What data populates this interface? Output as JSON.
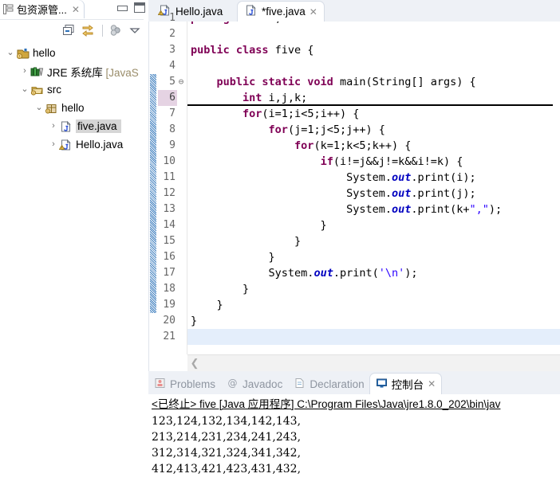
{
  "explorer": {
    "tab_label": "包资源管...",
    "tab_close": "✕",
    "toolbar": [
      {
        "name": "collapse-all-icon",
        "title": "全部折叠"
      },
      {
        "name": "link-with-editor-icon",
        "title": "与编辑器链接"
      },
      {
        "name": "focus-on-active-task-icon",
        "title": "聚焦于活动任务"
      },
      {
        "name": "view-menu-icon",
        "title": "视图菜单"
      }
    ],
    "window_buttons": {
      "minimize": "最小化",
      "maximize": "最大化"
    },
    "tree": [
      {
        "indent": 0,
        "twisty": "v",
        "icon": "java-project-icon",
        "label": "hello",
        "dim": "",
        "selected": false
      },
      {
        "indent": 1,
        "twisty": ">",
        "icon": "jre-library-icon",
        "label": "JRE 系统库 ",
        "dim": "[JavaS",
        "selected": false
      },
      {
        "indent": 1,
        "twisty": "v",
        "icon": "source-folder-icon",
        "label": "src",
        "dim": "",
        "selected": false
      },
      {
        "indent": 2,
        "twisty": "v",
        "icon": "package-icon",
        "label": "hello",
        "dim": "",
        "selected": false
      },
      {
        "indent": 3,
        "twisty": ">",
        "icon": "java-file-icon",
        "label": "five.java",
        "dim": "",
        "selected": true
      },
      {
        "indent": 3,
        "twisty": ">",
        "icon": "java-file-warning-icon",
        "label": "Hello.java",
        "dim": "",
        "selected": false
      }
    ]
  },
  "editor": {
    "tabs": [
      {
        "label": "Hello.java",
        "icon": "java-file-warning-icon",
        "active": false,
        "close": ""
      },
      {
        "label": "*five.java",
        "icon": "java-file-icon",
        "active": true,
        "close": "✕"
      }
    ],
    "current_line": 6,
    "selected_line": 21,
    "fold_lines": [
      5
    ],
    "change_bar_lines": [
      5,
      6,
      7,
      8,
      9,
      10,
      11,
      12,
      13,
      14,
      15,
      16,
      17,
      18,
      19
    ],
    "lines": [
      {
        "n": 1,
        "tokens": [
          {
            "t": "package ",
            "c": "kw"
          },
          {
            "t": "hello;",
            "c": "id"
          }
        ]
      },
      {
        "n": 2,
        "tokens": []
      },
      {
        "n": 3,
        "tokens": [
          {
            "t": "public class ",
            "c": "kw"
          },
          {
            "t": "five {",
            "c": "id"
          }
        ]
      },
      {
        "n": 4,
        "tokens": []
      },
      {
        "n": 5,
        "tokens": [
          {
            "t": "    ",
            "c": "id"
          },
          {
            "t": "public static void ",
            "c": "kw"
          },
          {
            "t": "main(String[] args) {",
            "c": "id"
          }
        ]
      },
      {
        "n": 6,
        "tokens": [
          {
            "t": "        ",
            "c": "id"
          },
          {
            "t": "int ",
            "c": "kw"
          },
          {
            "t": "i,j,k;",
            "c": "id"
          }
        ]
      },
      {
        "n": 7,
        "tokens": [
          {
            "t": "        ",
            "c": "id"
          },
          {
            "t": "for",
            "c": "kw"
          },
          {
            "t": "(i=1;i<5;i++) {",
            "c": "id"
          }
        ]
      },
      {
        "n": 8,
        "tokens": [
          {
            "t": "            ",
            "c": "id"
          },
          {
            "t": "for",
            "c": "kw"
          },
          {
            "t": "(j=1;j<5;j++) {",
            "c": "id"
          }
        ]
      },
      {
        "n": 9,
        "tokens": [
          {
            "t": "                ",
            "c": "id"
          },
          {
            "t": "for",
            "c": "kw"
          },
          {
            "t": "(k=1;k<5;k++) {",
            "c": "id"
          }
        ]
      },
      {
        "n": 10,
        "tokens": [
          {
            "t": "                    ",
            "c": "id"
          },
          {
            "t": "if",
            "c": "kw"
          },
          {
            "t": "(i!=j&&j!=k&&i!=k) {",
            "c": "id"
          }
        ]
      },
      {
        "n": 11,
        "tokens": [
          {
            "t": "                        System.",
            "c": "id"
          },
          {
            "t": "out",
            "c": "fld"
          },
          {
            "t": ".print(i);",
            "c": "id"
          }
        ]
      },
      {
        "n": 12,
        "tokens": [
          {
            "t": "                        System.",
            "c": "id"
          },
          {
            "t": "out",
            "c": "fld"
          },
          {
            "t": ".print(j);",
            "c": "id"
          }
        ]
      },
      {
        "n": 13,
        "tokens": [
          {
            "t": "                        System.",
            "c": "id"
          },
          {
            "t": "out",
            "c": "fld"
          },
          {
            "t": ".print(k+",
            "c": "id"
          },
          {
            "t": "\",\"",
            "c": "str"
          },
          {
            "t": ");",
            "c": "id"
          }
        ]
      },
      {
        "n": 14,
        "tokens": [
          {
            "t": "                    }",
            "c": "id"
          }
        ]
      },
      {
        "n": 15,
        "tokens": [
          {
            "t": "                }",
            "c": "id"
          }
        ]
      },
      {
        "n": 16,
        "tokens": [
          {
            "t": "            }",
            "c": "id"
          }
        ]
      },
      {
        "n": 17,
        "tokens": [
          {
            "t": "            System.",
            "c": "id"
          },
          {
            "t": "out",
            "c": "fld"
          },
          {
            "t": ".print(",
            "c": "id"
          },
          {
            "t": "'\\n'",
            "c": "str"
          },
          {
            "t": ");",
            "c": "id"
          }
        ]
      },
      {
        "n": 18,
        "tokens": [
          {
            "t": "        }",
            "c": "id"
          }
        ]
      },
      {
        "n": 19,
        "tokens": [
          {
            "t": "    }",
            "c": "id"
          }
        ]
      },
      {
        "n": 20,
        "tokens": [
          {
            "t": "}",
            "c": "id"
          }
        ]
      },
      {
        "n": 21,
        "tokens": []
      }
    ],
    "scroll_left_arrow": "❮"
  },
  "console": {
    "tabs": [
      {
        "label": "Problems",
        "icon": "problems-icon",
        "active": false,
        "close": ""
      },
      {
        "label": "Javadoc",
        "icon": "javadoc-icon",
        "active": false,
        "close": ""
      },
      {
        "label": "Declaration",
        "icon": "declaration-icon",
        "active": false,
        "close": ""
      },
      {
        "label": "控制台",
        "icon": "console-icon",
        "active": true,
        "close": "✕"
      }
    ],
    "header": "<已终止> five [Java 应用程序] C:\\Program Files\\Java\\jre1.8.0_202\\bin\\jav",
    "output": [
      "123,124,132,134,142,143,",
      "213,214,231,234,241,243,",
      "312,314,321,324,341,342,",
      "412,413,421,423,431,432,"
    ]
  },
  "colors": {
    "keyword": "#7f0055",
    "string": "#2a00ff",
    "field": "#0000c0",
    "current_line_gutter": "#e5d3e3",
    "selection": "#e4eefb",
    "tab_strip": "#eef1f6",
    "tree_selection": "#d6d6d6"
  }
}
